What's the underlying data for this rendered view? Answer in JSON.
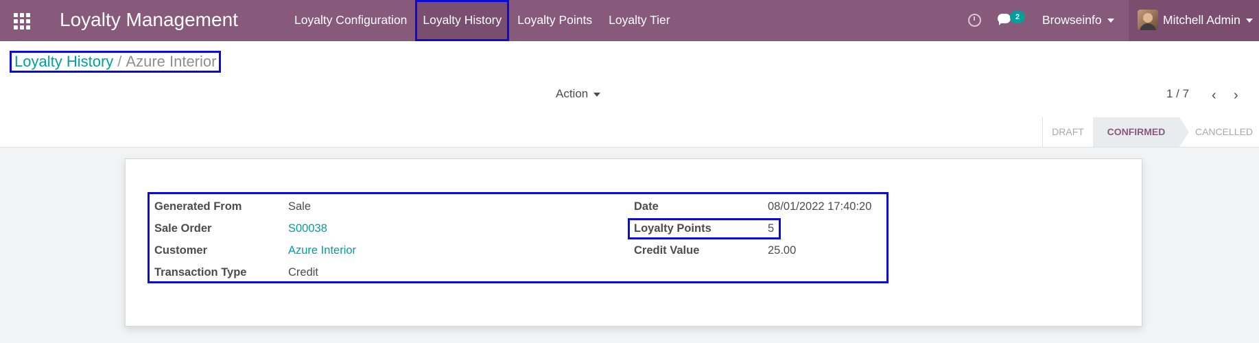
{
  "app": {
    "title": "Loyalty Management",
    "menu": [
      {
        "label": "Loyalty Configuration"
      },
      {
        "label": "Loyalty History"
      },
      {
        "label": "Loyalty Points"
      },
      {
        "label": "Loyalty Tier"
      }
    ],
    "message_count": "2",
    "company": "Browseinfo",
    "user": "Mitchell Admin"
  },
  "breadcrumb": {
    "parent": "Loyalty History",
    "separator": "/",
    "current": "Azure Interior"
  },
  "control_panel": {
    "action_label": "Action",
    "pager": "1 / 7",
    "prev_icon": "‹",
    "next_icon": "›"
  },
  "statusbar": {
    "stages": [
      {
        "label": "Draft",
        "active": false
      },
      {
        "label": "Confirmed",
        "active": true
      },
      {
        "label": "Cancelled",
        "active": false
      }
    ]
  },
  "form": {
    "left": [
      {
        "label": "Generated From",
        "value": "Sale"
      },
      {
        "label": "Sale Order",
        "value": "S00038"
      },
      {
        "label": "Customer",
        "value": "Azure Interior"
      },
      {
        "label": "Transaction Type",
        "value": "Credit"
      }
    ],
    "right": [
      {
        "label": "Date",
        "value": "08/01/2022 17:40:20"
      },
      {
        "label": "Loyalty Points",
        "value": "5"
      },
      {
        "label": "Credit Value",
        "value": "25.00"
      }
    ]
  },
  "colors": {
    "brand": "#875a7b",
    "link": "#00a09d",
    "highlight": "#0b0bd8"
  }
}
